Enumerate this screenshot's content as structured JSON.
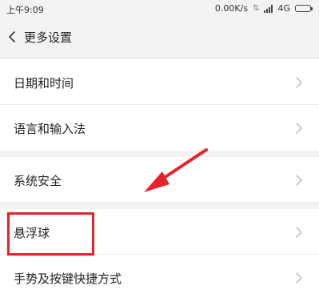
{
  "status_bar": {
    "time": "上午9:09",
    "network_speed": "0.00K/s",
    "network_type": "4G",
    "icons": [
      "data-arrows-icon",
      "signal-icon",
      "battery-icon"
    ]
  },
  "header": {
    "back_icon": "chevron-left-icon",
    "title": "更多设置"
  },
  "settings": {
    "group1": [
      {
        "label": "日期和时间"
      },
      {
        "label": "语言和输入法"
      }
    ],
    "group2": [
      {
        "label": "系统安全"
      },
      {
        "label": "悬浮球"
      },
      {
        "label": "手势及按键快捷方式"
      }
    ]
  },
  "annotation": {
    "highlight_color": "#e8222a",
    "highlighted_item": "悬浮球"
  },
  "colors": {
    "background": "#f3f3f3",
    "row_background": "#ffffff",
    "chevron": "#b5b5b5"
  }
}
